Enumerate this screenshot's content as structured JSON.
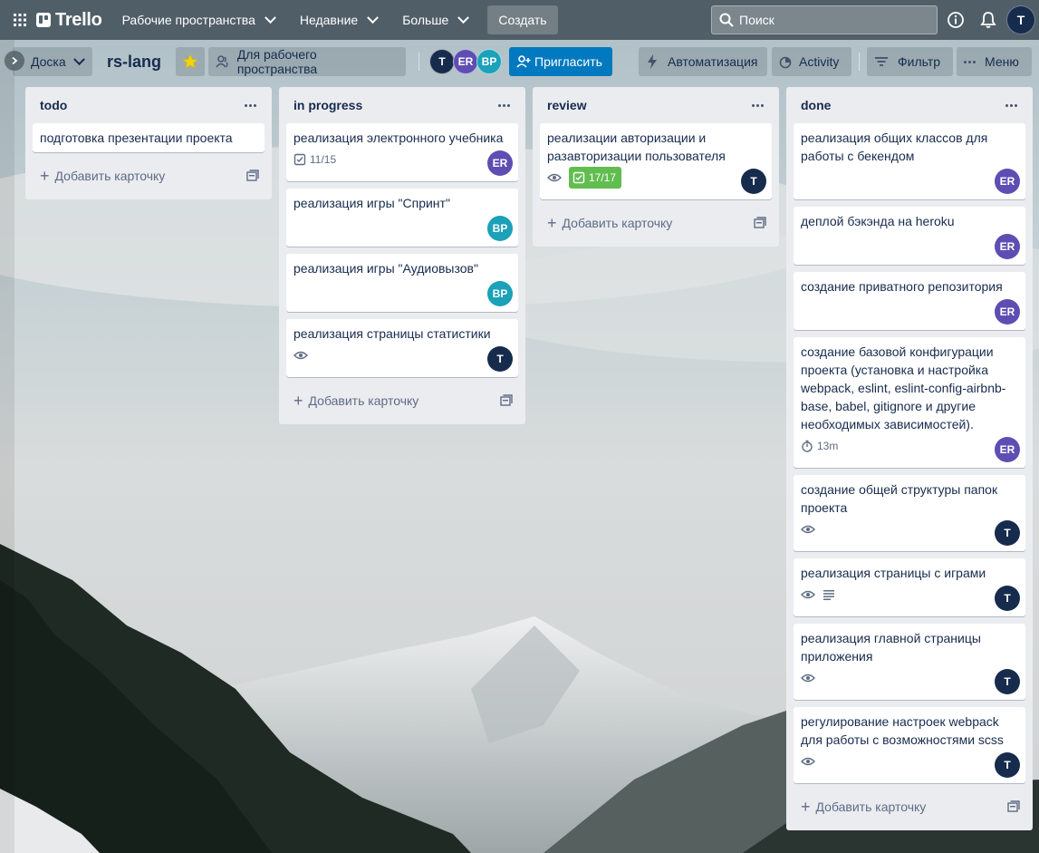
{
  "header": {
    "logo": "Trello",
    "menus": [
      {
        "label": "Рабочие пространства"
      },
      {
        "label": "Недавние"
      },
      {
        "label": "Больше"
      }
    ],
    "create_label": "Создать",
    "search_placeholder": "Поиск",
    "user_initial": "T"
  },
  "board": {
    "view_label": "Доска",
    "title": "rs-lang",
    "visibility_label": "Для рабочего пространства",
    "members": [
      "T",
      "ER",
      "BP"
    ],
    "invite_label": "Пригласить",
    "automation_label": "Автоматизация",
    "activity_label": "Activity",
    "filter_label": "Фильтр",
    "menu_label": "Меню"
  },
  "lists": [
    {
      "title": "todo",
      "add_label": "Добавить карточку",
      "cards": [
        {
          "text": "подготовка презентации проекта"
        }
      ]
    },
    {
      "title": "in progress",
      "add_label": "Добавить карточку",
      "cards": [
        {
          "text": "реализация электронного учебника",
          "checklist": "11/15",
          "member": "ER"
        },
        {
          "text": "реализация игры \"Спринт\"",
          "member": "BP"
        },
        {
          "text": "реализация игры \"Аудиовызов\"",
          "member": "BP"
        },
        {
          "text": "реализация страницы статистики",
          "watch": true,
          "member": "T"
        }
      ]
    },
    {
      "title": "review",
      "add_label": "Добавить карточку",
      "cards": [
        {
          "text": "реализации авторизации и разавторизации пользователя",
          "watch": true,
          "checklist_done": "17/17",
          "member": "T"
        }
      ]
    },
    {
      "title": "done",
      "add_label": "Добавить карточку",
      "cards": [
        {
          "text": "реализация общих классов для работы с бекендом",
          "member": "ER"
        },
        {
          "text": "деплой бэкэнда на heroku",
          "member": "ER"
        },
        {
          "text": "создание приватного репозитория",
          "member": "ER"
        },
        {
          "text": "создание базовой конфигурации проекта (установка и настройка webpack, eslint, eslint-config-airbnb-base, babel, gitignore и другие необходимых зависимостей).",
          "time": "13m",
          "member": "ER"
        },
        {
          "text": "создание общей структуры папок проекта",
          "watch": true,
          "member": "T"
        },
        {
          "text": "реализация страницы с играми",
          "watch": true,
          "description": true,
          "member": "T"
        },
        {
          "text": "реализация главной страницы приложения",
          "watch": true,
          "member": "T"
        },
        {
          "text": "регулирование настроек webpack для работы с возможностями scss",
          "watch": true,
          "member": "T"
        }
      ]
    }
  ]
}
